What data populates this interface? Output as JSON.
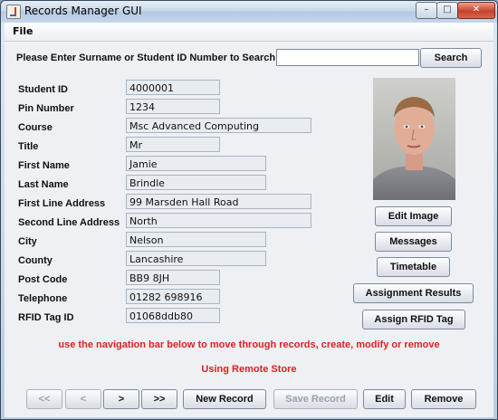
{
  "window": {
    "title": "Records Manager GUI",
    "minimize": "–",
    "maximize": "□",
    "close": "✕"
  },
  "menu": {
    "file": "File"
  },
  "search": {
    "label": "Please Enter Surname or Student ID Number to Search",
    "value": "",
    "button": "Search"
  },
  "fields": [
    {
      "label": "Student ID",
      "value": "4000001"
    },
    {
      "label": "Pin Number",
      "value": "1234"
    },
    {
      "label": "Course",
      "value": "Msc Advanced Computing"
    },
    {
      "label": "Title",
      "value": "Mr"
    },
    {
      "label": "First Name",
      "value": "Jamie"
    },
    {
      "label": "Last Name",
      "value": "Brindle"
    },
    {
      "label": "First Line Address",
      "value": "99 Marsden Hall Road"
    },
    {
      "label": "Second Line Address",
      "value": "North"
    },
    {
      "label": "City",
      "value": "Nelson"
    },
    {
      "label": "County",
      "value": "Lancashire"
    },
    {
      "label": "Post Code",
      "value": "BB9 8JH"
    },
    {
      "label": "Telephone",
      "value": "01282 698916"
    },
    {
      "label": "RFID Tag ID",
      "value": "01068ddb80"
    }
  ],
  "side_buttons": {
    "edit_image": "Edit Image",
    "messages": "Messages",
    "timetable": "Timetable",
    "assignment_results": "Assignment Results",
    "assign_rfid": "Assign RFID Tag"
  },
  "messages": {
    "navigation": "use the navigation bar below to move through records, create, modify or remove",
    "store": "Using Remote Store"
  },
  "nav": {
    "first": "<<",
    "prev": "<",
    "next": ">",
    "last": ">>",
    "new_record": "New Record",
    "save_record": "Save Record",
    "edit": "Edit",
    "remove": "Remove"
  },
  "colors": {
    "message": "#e02020",
    "window_frame": "#b9cde0"
  }
}
